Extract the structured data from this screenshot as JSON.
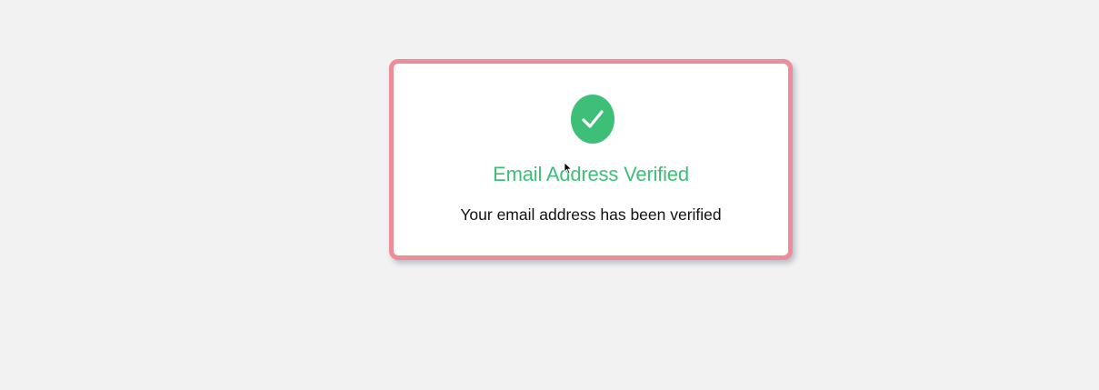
{
  "dialog": {
    "title": "Email Address Verified",
    "message": "Your email address has been verified",
    "icon": "checkmark-circle-icon"
  },
  "colors": {
    "page_background": "#f2f2f2",
    "card_background": "#ffffff",
    "card_border": "#ee8c99",
    "success_green": "#3ebf78",
    "message_text": "#111111"
  }
}
